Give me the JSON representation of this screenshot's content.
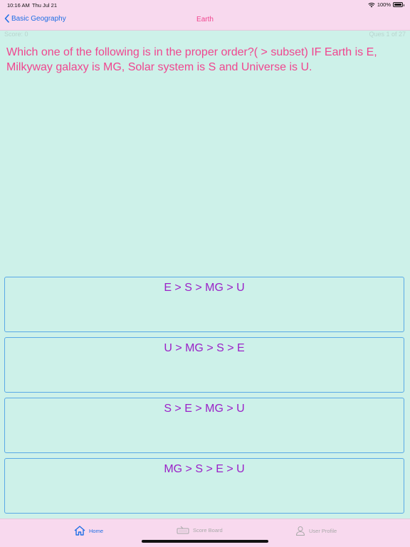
{
  "status": {
    "time": "10:16 AM",
    "date": "Thu Jul 21",
    "battery": "100%"
  },
  "nav": {
    "back_label": "Basic Geography",
    "title": "Earth"
  },
  "quiz": {
    "score": "Score: 0",
    "progress": "Ques 1 of 27",
    "question": "Which one of the following is in the proper order?( > subset) IF Earth is E, Milkyway galaxy is MG, Solar system is S and Universe is U.",
    "options": [
      "E > S > MG > U",
      "U > MG > S > E",
      "S > E > MG > U",
      "MG > S > E > U"
    ]
  },
  "tabs": [
    {
      "label": "Home",
      "icon": "home-icon",
      "active": true
    },
    {
      "label": "Score Board",
      "icon": "keyboard-icon",
      "active": false
    },
    {
      "label": "User Profile",
      "icon": "user-icon",
      "active": false
    }
  ],
  "colors": {
    "accent": "#f0468f",
    "link": "#1f6fe5",
    "option_text": "#9b22c8",
    "background": "#cdf1e9",
    "bars": "#f8d9ee"
  }
}
